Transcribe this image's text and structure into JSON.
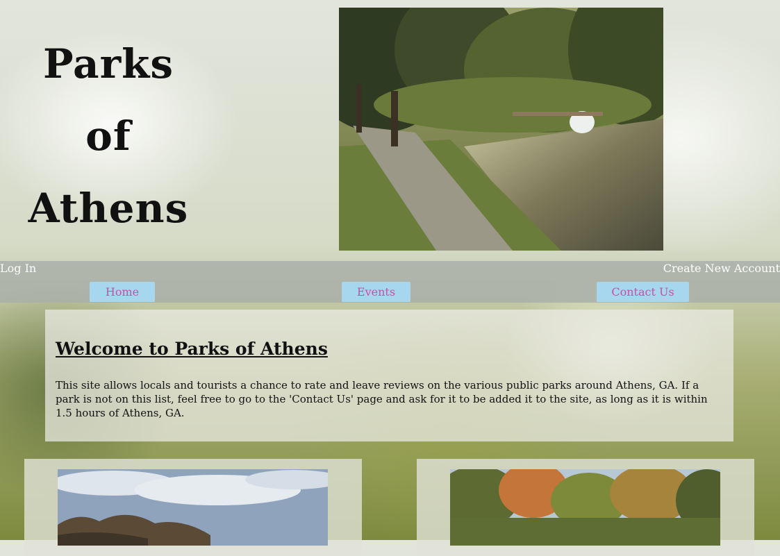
{
  "site": {
    "title_lines": [
      "Parks",
      "of",
      "Athens"
    ]
  },
  "account": {
    "login": "Log In",
    "create": "Create New Account"
  },
  "nav": {
    "home": "Home",
    "events": "Events",
    "contact": "Contact Us"
  },
  "welcome": {
    "heading": "Welcome to Parks of Athens",
    "body": "This site allows locals and tourists a chance to rate and leave reviews on the various public parks around Athens, GA. If a park is not on this list, feel free to go to the 'Contact Us' page and ask for it to be added it to the site, as long as it is within 1.5 hours of Athens, GA."
  },
  "colors": {
    "nav_button_bg": "#a6d7ef",
    "nav_button_text": "#c84fa6",
    "navbar_bg": "#aaafaa"
  }
}
